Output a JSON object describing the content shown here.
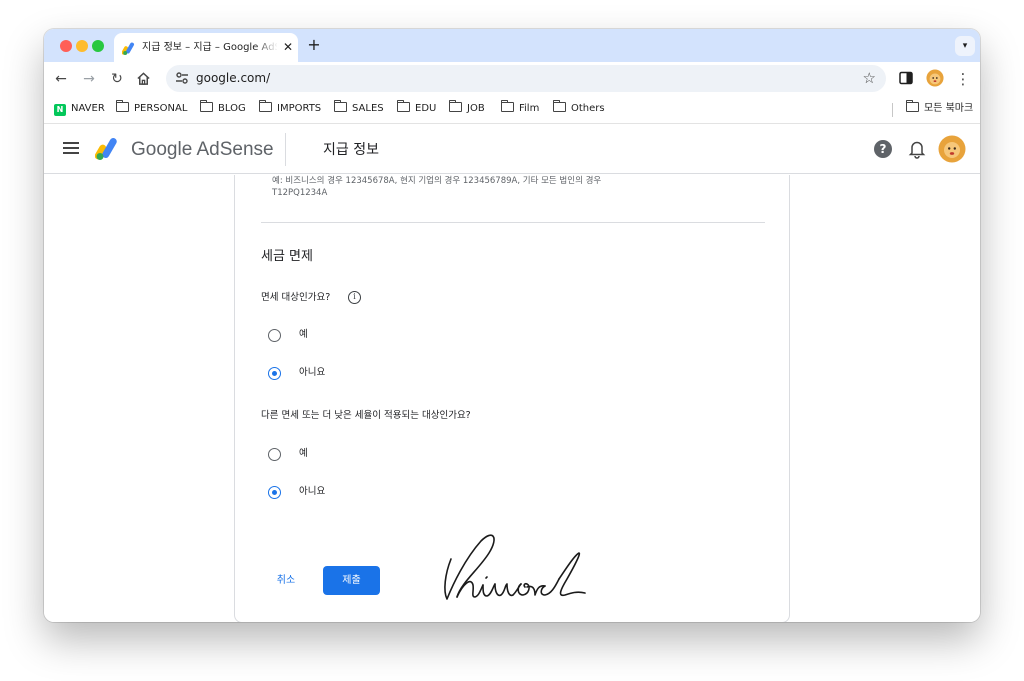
{
  "browser": {
    "tab_title": "지급 정보 – 지급 – Google AdSense",
    "tab_close": "✕",
    "new_tab": "+",
    "url": "google.com/",
    "bookmarks": [
      "NAVER",
      "PERSONAL",
      "BLOG",
      "IMPORTS",
      "SALES",
      "EDU",
      "JOB",
      "Film",
      "Others"
    ],
    "all_bookmarks": "모든 북마크"
  },
  "header": {
    "product_name": "Google AdSense",
    "page_title": "지급 정보",
    "help": "?"
  },
  "form": {
    "tax_id_hint": "예: 비즈니스의 경우 12345678A, 현지 기업의 경우 123456789A, 기타 모든 법인의 경우 T12PQ1234A",
    "section_title": "세금 면제",
    "question1": "면세 대상인가요?",
    "question1_options": [
      {
        "label": "예",
        "checked": false
      },
      {
        "label": "아니요",
        "checked": true
      }
    ],
    "question2": "다른 면세 또는 더 낮은 세율이 적용되는 대상인가요?",
    "question2_options": [
      {
        "label": "예",
        "checked": false
      },
      {
        "label": "아니요",
        "checked": true
      }
    ],
    "cancel_label": "취소",
    "submit_label": "제출"
  },
  "colors": {
    "accent": "#1a73e8",
    "tabstrip": "#d3e3fd"
  }
}
